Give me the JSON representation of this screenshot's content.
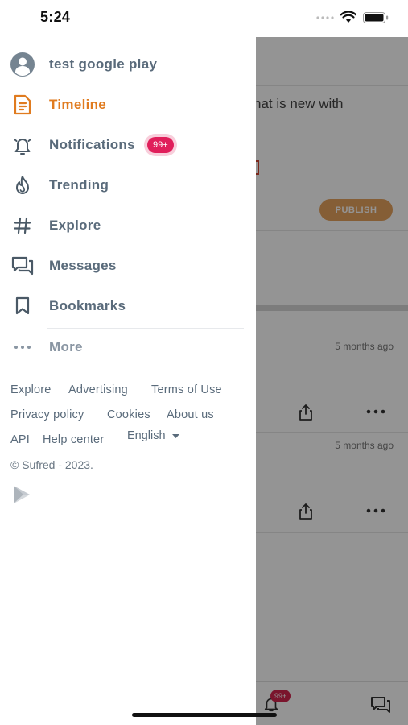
{
  "status_bar": {
    "time": "5:24",
    "icons": [
      "signal-dots-icon",
      "wifi-icon",
      "battery-icon"
    ]
  },
  "drawer": {
    "profile_name": "test google play",
    "items": [
      {
        "label": "Timeline",
        "icon": "timeline-icon",
        "active": true
      },
      {
        "label": "Notifications",
        "icon": "bell-icon",
        "badge": "99+"
      },
      {
        "label": "Trending",
        "icon": "flame-icon"
      },
      {
        "label": "Explore",
        "icon": "hashtag-icon"
      },
      {
        "label": "Messages",
        "icon": "messages-icon"
      },
      {
        "label": "Bookmarks",
        "icon": "bookmark-icon"
      }
    ],
    "more_label": "More",
    "footer_links": {
      "explore": "Explore",
      "advertising": "Advertising",
      "terms": "Terms of Use",
      "privacy": "Privacy policy",
      "cookies": "Cookies",
      "about": "About us",
      "api": "API",
      "help": "Help center"
    },
    "language": "English",
    "copyright": "© Sufred - 2023."
  },
  "background": {
    "compose_placeholder": "hat is new with",
    "publish_label": "PUBLISH",
    "post_times": [
      "5 months ago",
      "5 months ago"
    ],
    "bottom_badge": "99+"
  },
  "colors": {
    "accent": "#e07b1f",
    "badge": "#e01f5b",
    "text": "#5a6b7b"
  }
}
